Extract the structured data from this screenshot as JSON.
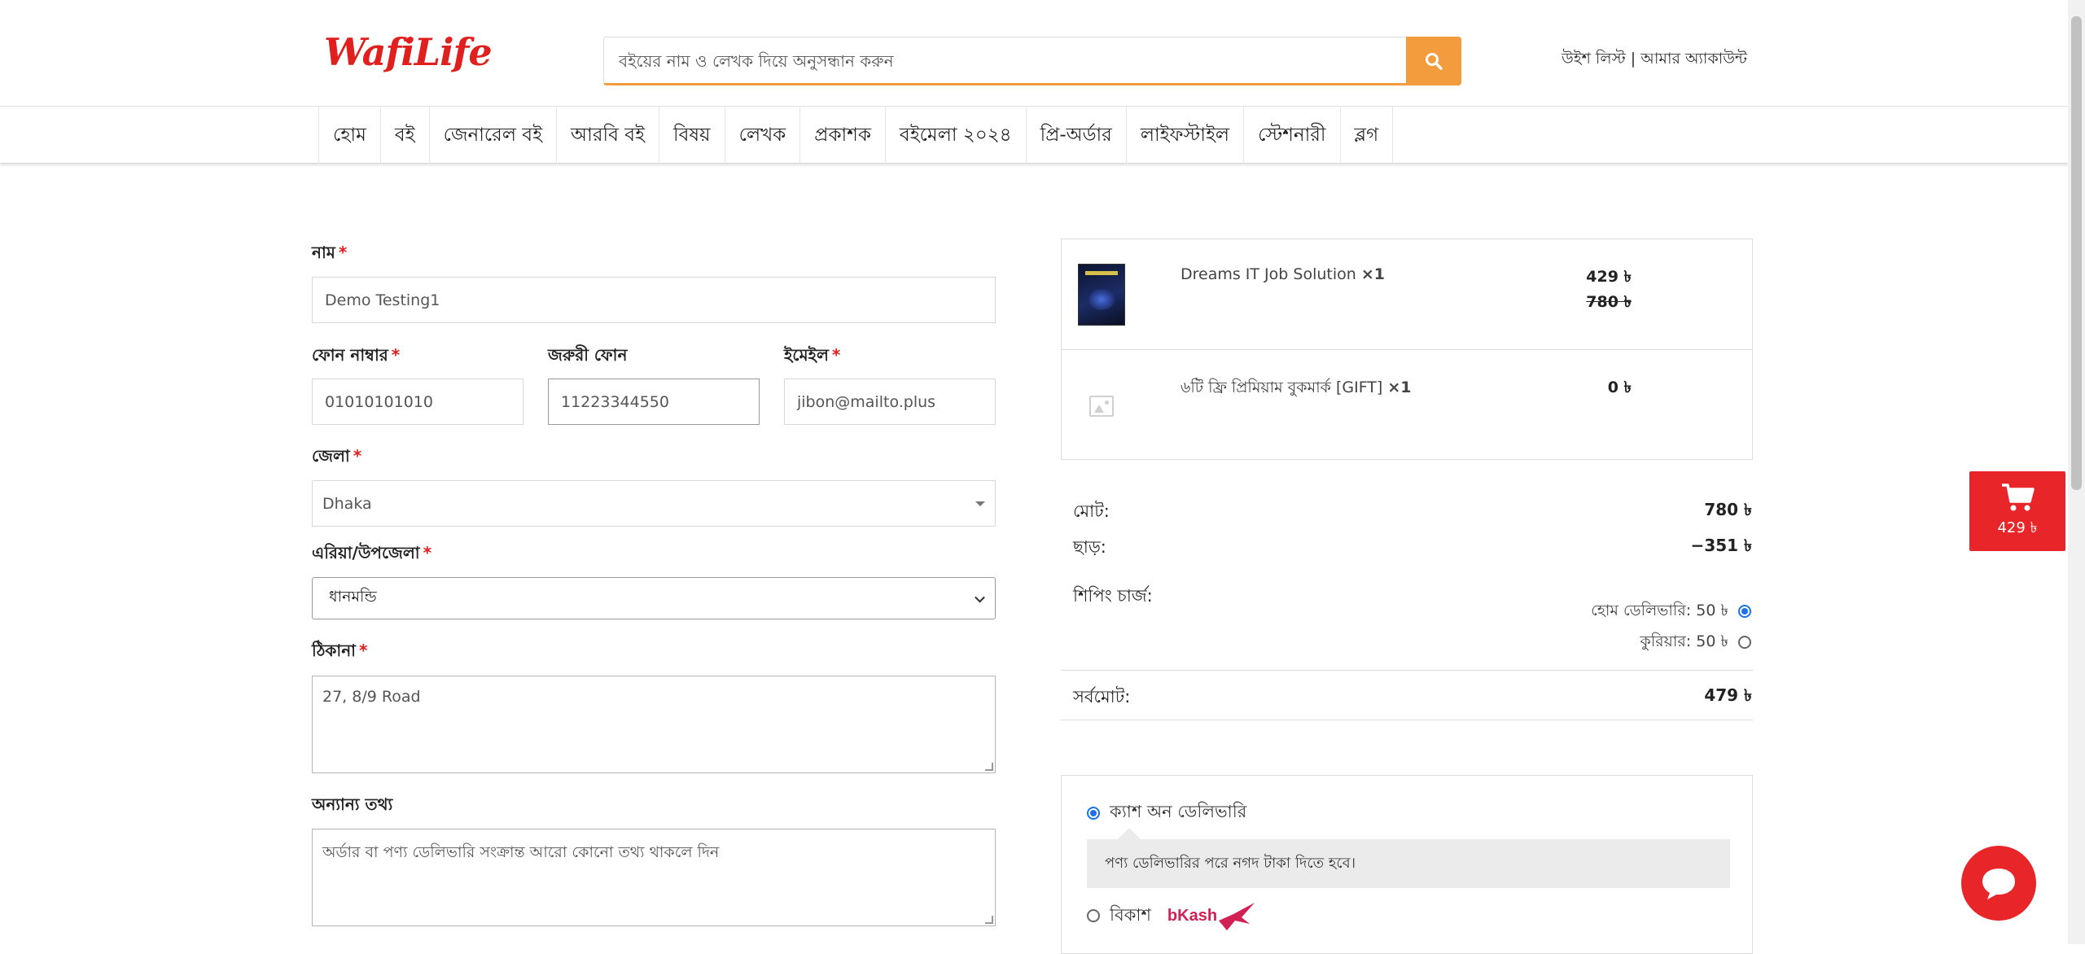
{
  "header": {
    "logo_text": "WafiLife",
    "search_placeholder": "বইয়ের নাম ও লেখক দিয়ে অনুসন্ধান করুন",
    "wishlist": "উইশ লিস্ট",
    "separator": " | ",
    "account": "আমার অ্যাকাউন্ট"
  },
  "nav": {
    "items": [
      "হোম",
      "বই",
      "জেনারেল বই",
      "আরবি বই",
      "বিষয়",
      "লেখক",
      "প্রকাশক",
      "বইমেলা ২০২৪",
      "প্রি-অর্ডার",
      "লাইফস্টাইল",
      "স্টেশনারী",
      "ব্লগ"
    ]
  },
  "form": {
    "name_label": "নাম",
    "name_value": "Demo Testing1",
    "phone_label": "ফোন নাম্বার",
    "phone_value": "01010101010",
    "emergency_label": "জরুরী ফোন",
    "emergency_value": "11223344550",
    "email_label": "ইমেইল",
    "email_value": "jibon@mailto.plus",
    "district_label": "জেলা",
    "district_value": "Dhaka",
    "area_label": "এরিয়া/উপজেলা",
    "area_value": "ধানমন্ডি",
    "address_label": "ঠিকানা",
    "address_value": "27, 8/9 Road",
    "other_label": "অন্যান্য তথ্য",
    "other_placeholder": "অর্ডার বা পণ্য ডেলিভারি সংক্রান্ত আরো কোনো তথ্য থাকলে দিন",
    "required_mark": "*"
  },
  "cart": {
    "items": [
      {
        "name": "Dreams IT Job Solution",
        "qty": "×1",
        "price": "429 ৳",
        "old_price": "780 ৳"
      },
      {
        "name": "৬টি ফ্রি প্রিমিয়াম বুকমার্ক [GIFT]",
        "qty": "×1",
        "price": "0 ৳"
      }
    ]
  },
  "summary": {
    "subtotal_label": "মোট:",
    "subtotal_value": "780 ৳",
    "discount_label": "ছাড়:",
    "discount_value": "−351 ৳",
    "shipping_label": "শিপিং চার্জ:",
    "shipping_options": [
      {
        "label": "হোম ডেলিভারি: 50 ৳",
        "selected": true
      },
      {
        "label": "কুরিয়ার: 50 ৳",
        "selected": false
      }
    ],
    "total_label": "সর্বমোট:",
    "total_value": "479 ৳"
  },
  "payment": {
    "cod_label": "ক্যাশ অন ডেলিভারি",
    "cod_desc": "পণ্য ডেলিভারির পরে নগদ টাকা দিতে হবে।",
    "bkash_label": "বিকাশ",
    "bkash_logo_text": "bKash"
  },
  "floating_cart": {
    "amount": "429 ৳",
    "icon": "cart-icon"
  },
  "colors": {
    "brand_red": "#e8262a",
    "search_orange": "#f39c3d",
    "radio_blue": "#1a73e8",
    "bkash_pink": "#d12053"
  }
}
